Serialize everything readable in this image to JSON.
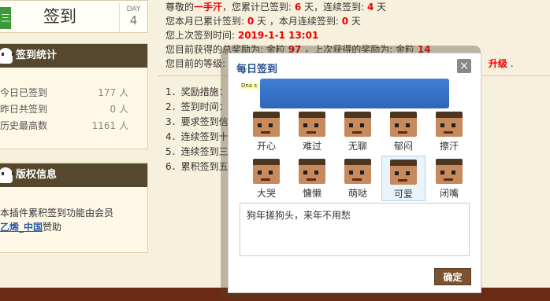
{
  "header": {
    "left_tab": "三",
    "title": "签到",
    "day_label": "DAY",
    "day_value": "4"
  },
  "stats_panel": {
    "title": "签到统计",
    "rows": [
      {
        "label": "今日已签到",
        "value": "177 人"
      },
      {
        "label": "昨日共签到",
        "value": "0 人"
      },
      {
        "label": "历史最高数",
        "value": "1161 人"
      }
    ]
  },
  "copyright_panel": {
    "title": "版权信息",
    "line1": "本插件累积签到功能由会员",
    "link": "乙烯_中国",
    "line2_suffix": "赞助"
  },
  "summary": {
    "l1_a": "尊敬的",
    "l1_name": "一手汗",
    "l1_b": "，您累计已签到: ",
    "l1_days": "6",
    "l1_c": " 天，连续签到: ",
    "l1_cont": "4",
    "l1_d": " 天",
    "l2_a": "您本月已累计签到: ",
    "l2_v": "0",
    "l2_b": " 天 ，本月连续签到: ",
    "l2_v2": "0",
    "l2_c": " 天",
    "l3_a": "您上次签到时间: ",
    "l3_v": "2019-1-1 13:01",
    "l4_a": "您目前获得的总奖励为: 金粒 ",
    "l4_v": "97",
    "l4_b": " ，上次获得的奖励为: 金粒 ",
    "l4_v2": "14",
    "l5_a": "您目前的等级: ",
    "l5_v": "升级",
    "l5_tail": " ."
  },
  "rules": [
    "1．奖励措施：",
    "2．签到时间：",
    "3．要求签到信",
    "4．连续签到十",
    "5．连续签到三",
    "6．累积签到五"
  ],
  "dialog": {
    "title": "每日签到",
    "close": "×",
    "ad_text": "Dna s",
    "moods": [
      "开心",
      "难过",
      "无聊",
      "郁闷",
      "擦汗",
      "大哭",
      "慵懒",
      "萌哒",
      "可爱",
      "闭嘴"
    ],
    "selected": "可爱",
    "message": "狗年搓狗头，来年不用愁",
    "confirm": "确定"
  },
  "colors": {
    "accent_red": "#e00000",
    "panel_brown": "#55482e",
    "link_blue": "#2a5caa",
    "dialog_title": "#234f8f",
    "confirm_brown": "#7a5332"
  }
}
